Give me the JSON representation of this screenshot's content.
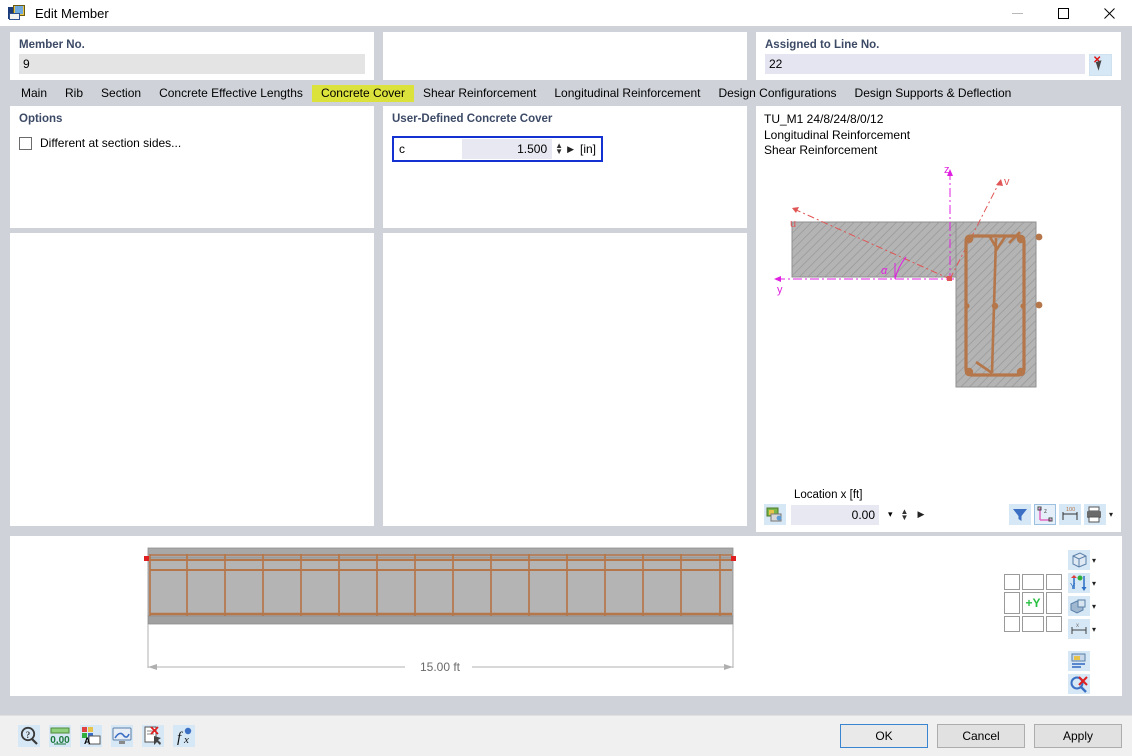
{
  "window": {
    "title": "Edit Member",
    "icon": "member-edit-icon",
    "controls": {
      "minimize": "—",
      "maximize": "☐",
      "close": "✕"
    }
  },
  "header": {
    "member": {
      "label": "Member No.",
      "value": "9"
    },
    "middle": {
      "label": "",
      "value": ""
    },
    "line": {
      "label": "Assigned to Line No.",
      "value": "22",
      "pick_icon": "select-pointer-icon"
    }
  },
  "tabs": [
    {
      "label": "Main",
      "active": false
    },
    {
      "label": "Rib",
      "active": false
    },
    {
      "label": "Section",
      "active": false
    },
    {
      "label": "Concrete Effective Lengths",
      "active": false
    },
    {
      "label": "Concrete Cover",
      "active": true
    },
    {
      "label": "Shear Reinforcement",
      "active": false
    },
    {
      "label": "Longitudinal Reinforcement",
      "active": false
    },
    {
      "label": "Design Configurations",
      "active": false
    },
    {
      "label": "Design Supports & Deflection",
      "active": false
    }
  ],
  "options_panel": {
    "title": "Options",
    "checkbox_label": "Different at section sides...",
    "checked": false
  },
  "cover_panel": {
    "title": "User-Defined Concrete Cover",
    "field_label": "c",
    "value": "1.500",
    "unit": "[in]"
  },
  "section_panel": {
    "info_lines": [
      "TU_M1 24/8/24/8/0/12",
      "Longitudinal Reinforcement",
      "Shear Reinforcement"
    ],
    "axis_labels": {
      "z": "z",
      "y": "y",
      "u": "u",
      "v": "v",
      "alpha": "α"
    },
    "location_label": "Location x [ft]",
    "location_value": "0.00",
    "toolbar_left": [
      "render-settings-icon"
    ],
    "toolbar_right": [
      "filter-icon",
      "coordinate-system-icon",
      "dimension-icon",
      "print-icon"
    ]
  },
  "beam_view": {
    "dimension_label": "15.00 ft",
    "nav_cube_label": "+Y",
    "tools": [
      "view-cube-icon",
      "axis-orientation-icon",
      "render-mode-icon",
      "dimension-style-icon",
      "layers-icon",
      "zoom-reset-icon"
    ]
  },
  "footer": {
    "icons": [
      "help-icon",
      "numeric-format-icon",
      "color-legend-icon",
      "display-settings-icon",
      "clear-selection-icon",
      "formula-icon"
    ],
    "buttons": [
      {
        "label": "OK",
        "primary": true
      },
      {
        "label": "Cancel",
        "primary": false
      },
      {
        "label": "Apply",
        "primary": false
      }
    ]
  },
  "colors": {
    "accent_blue": "#1432d2",
    "tab_highlight": "#dce23c",
    "rebar": "#b5764a",
    "concrete": "#b0b0b0",
    "axis_magenta": "#e020e0",
    "axis_red": "#e05555",
    "label_blue": "#3c4a66"
  }
}
